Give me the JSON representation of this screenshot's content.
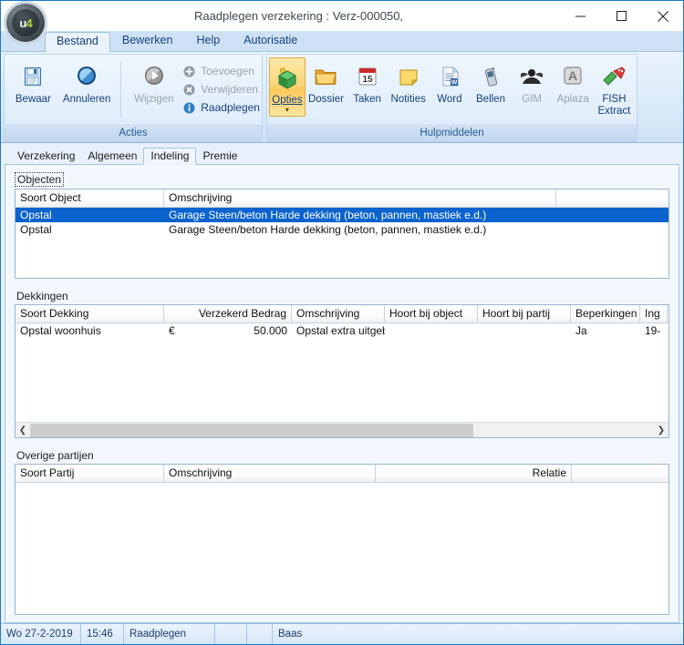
{
  "window": {
    "title": "Raadplegen verzekering : Verz-000050,",
    "logo_text_u": "u",
    "logo_text_4": "4",
    "minimize": "minimize-icon",
    "maximize": "maximize-icon",
    "close": "close-icon",
    "accent": "#1a7bc4"
  },
  "menu": {
    "tabs": [
      {
        "label": "Bestand",
        "active": true
      },
      {
        "label": "Bewerken",
        "active": false
      },
      {
        "label": "Help",
        "active": false
      },
      {
        "label": "Autorisatie",
        "active": false
      }
    ]
  },
  "ribbon": {
    "groups": [
      {
        "caption": "Acties",
        "large_buttons": [
          {
            "label": "Bewaar",
            "icon": "save-floppy-icon",
            "enabled": true
          },
          {
            "label": "Annuleren",
            "icon": "cancel-circle-icon",
            "enabled": true
          },
          {
            "label": "Wijzigen",
            "icon": "play-circle-icon",
            "enabled": false
          }
        ],
        "small_buttons": [
          {
            "label": "Toevoegen",
            "icon": "add-icon",
            "enabled": false
          },
          {
            "label": "Verwijderen",
            "icon": "delete-icon",
            "enabled": false
          },
          {
            "label": "Raadplegen",
            "icon": "info-icon",
            "enabled": true
          }
        ]
      },
      {
        "caption": "Hulpmiddelen",
        "large_buttons": [
          {
            "label": "Opties",
            "icon": "options-cube-icon",
            "enabled": true,
            "selected": true,
            "dropdown": true
          },
          {
            "label": "Dossier",
            "icon": "folder-icon",
            "enabled": true
          },
          {
            "label": "Taken",
            "icon": "calendar-icon",
            "enabled": true
          },
          {
            "label": "Notities",
            "icon": "note-icon",
            "enabled": true
          },
          {
            "label": "Word",
            "icon": "word-document-icon",
            "enabled": true
          },
          {
            "label": "Bellen",
            "icon": "phone-icon",
            "enabled": true
          },
          {
            "label": "GIM",
            "icon": "gim-icon",
            "enabled": false
          },
          {
            "label": "Aplaza",
            "icon": "aplaza-icon",
            "enabled": false
          },
          {
            "label": "FISH Extract",
            "icon": "fish-extract-icon",
            "enabled": true
          }
        ]
      }
    ]
  },
  "page_tabs": [
    {
      "label": "Verzekering",
      "active": false
    },
    {
      "label": "Algemeen",
      "active": false
    },
    {
      "label": "Indeling",
      "active": true
    },
    {
      "label": "Premie",
      "active": false
    }
  ],
  "objecten": {
    "label": "Objecten",
    "columns": [
      "Soort Object",
      "Omschrijving",
      ""
    ],
    "rows": [
      {
        "cells": [
          "Opstal",
          "Garage Steen/beton Harde dekking (beton, pannen, mastiek e.d.)",
          ""
        ],
        "selected": true
      },
      {
        "cells": [
          "Opstal",
          "Garage Steen/beton Harde dekking (beton, pannen, mastiek e.d.)",
          ""
        ],
        "selected": false
      }
    ]
  },
  "dekkingen": {
    "label": "Dekkingen",
    "columns": [
      "Soort Dekking",
      "Verzekerd Bedrag",
      "Omschrijving",
      "Hoort bij object",
      "Hoort bij partij",
      "Beperkingen",
      "Ing"
    ],
    "rows": [
      {
        "cells": [
          "Opstal woonhuis",
          "€",
          "50.000",
          "Opstal extra uitgeb",
          "",
          "",
          "Ja",
          "19-"
        ],
        "selected": false
      }
    ],
    "scrollbar": {
      "left_arrow": "chevron-left-icon",
      "right_arrow": "chevron-right-icon",
      "thumb_percent": 71
    }
  },
  "overige_partijen": {
    "label": "Overige partijen",
    "columns": [
      "Soort Partij",
      "Omschrijving",
      "Relatie",
      ""
    ],
    "rows": []
  },
  "statusbar": {
    "cells": [
      "Wo  27-2-2019",
      "15:46",
      "Raadplegen",
      "",
      "",
      "Baas"
    ]
  }
}
